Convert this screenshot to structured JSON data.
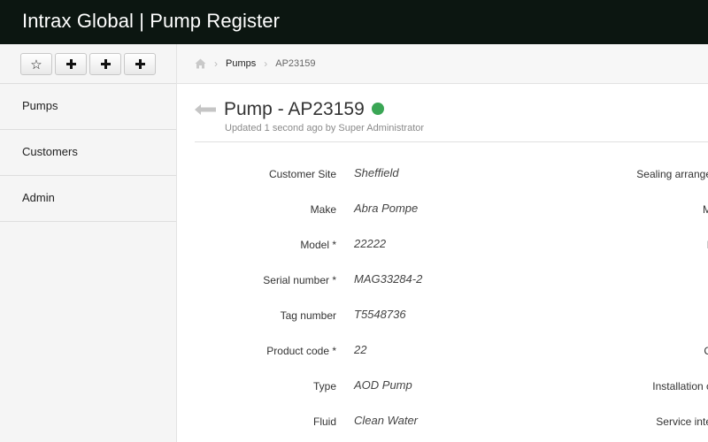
{
  "app": {
    "title": "Intrax Global | Pump Register"
  },
  "toolbar": {
    "buttons": [
      {
        "icon": "star-icon",
        "glyph": "☆"
      },
      {
        "icon": "plus-icon",
        "glyph": "+"
      },
      {
        "icon": "plus-icon",
        "glyph": "+"
      },
      {
        "icon": "plus-icon",
        "glyph": "+"
      }
    ]
  },
  "sidebar": {
    "items": [
      {
        "label": "Pumps"
      },
      {
        "label": "Customers"
      },
      {
        "label": "Admin"
      }
    ]
  },
  "breadcrumb": {
    "items": [
      "Pumps",
      "AP23159"
    ]
  },
  "record": {
    "title": "Pump - AP23159",
    "status_color": "#3aa655",
    "updated": "Updated 1 second ago by Super Administrator"
  },
  "fields": [
    {
      "label": "Customer Site",
      "value": "Sheffield"
    },
    {
      "label": "Make",
      "value": "Abra Pompe"
    },
    {
      "label": "Model *",
      "value": "22222"
    },
    {
      "label": "Serial number *",
      "value": "MAG33284-2"
    },
    {
      "label": "Tag number",
      "value": "T5548736"
    },
    {
      "label": "Product code *",
      "value": "22"
    },
    {
      "label": "Type",
      "value": "AOD Pump"
    },
    {
      "label": "Fluid",
      "value": "Clean Water"
    }
  ],
  "right_fields": [
    {
      "label": "Sealing arrange"
    },
    {
      "label": "M"
    },
    {
      "label": "I"
    },
    {
      "label": ""
    },
    {
      "label": ""
    },
    {
      "label": "C"
    },
    {
      "label": "Installation c"
    },
    {
      "label": "Service inte"
    }
  ]
}
